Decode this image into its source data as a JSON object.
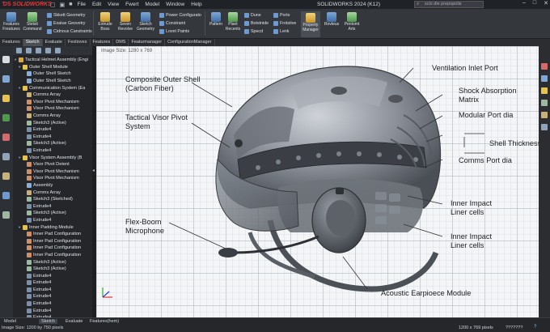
{
  "titlebar": {
    "logo_text": "SOLIDWORKS",
    "menus": [
      "File",
      "Edit",
      "View",
      "Fwert",
      "Model",
      "Window",
      "Help"
    ],
    "app_title": "SOLIDWORKS 2024 (K12)",
    "search_placeholder": "sclo dle prepopolis"
  },
  "command_manager": {
    "big_buttons": [
      {
        "label": "Features\nFreatures",
        "icon": "features-icon"
      },
      {
        "label": "Stetsit\nCommand",
        "icon": "sketch-icon"
      },
      {
        "label": "Extrude\nBoss",
        "icon": "extrude-icon"
      },
      {
        "label": "Seven\nRevolve",
        "icon": "revolve-icon"
      },
      {
        "label": "Sketch\nGeometry",
        "icon": "sketch-geometry-icon"
      },
      {
        "label": "Pattern",
        "icon": "pattern-icon"
      },
      {
        "label": "Plant\nRecents",
        "icon": "plant-icon"
      },
      {
        "label": "Property\nManager",
        "icon": "property-icon"
      },
      {
        "label": "Rovteus",
        "icon": "route-icon"
      },
      {
        "label": "Pentomt\nArts",
        "icon": "arts-icon"
      }
    ],
    "rows_a": [
      "Skkett Geometry",
      "Exatue Geovetry",
      "Cidnous Canstraints"
    ],
    "rows_b": [
      "Power Configurato",
      "Constraint",
      "Lovet Paints"
    ],
    "rows_c": [
      "Dune",
      "Botstnide",
      "Specd"
    ],
    "rows_d": [
      "Ports",
      "Frotstive",
      "Lenk"
    ]
  },
  "tabs": [
    "Features",
    "Sketch",
    "Evaluate",
    "Festioves",
    "Features",
    "DMS",
    "Featurmanager",
    "ConfigurationManager"
  ],
  "tree": {
    "rows": [
      {
        "indent": 0,
        "toggle": "▾",
        "icon": "ic-asm",
        "label": "Tactical Helmet Assembly (Engi"
      },
      {
        "indent": 1,
        "toggle": "▾",
        "icon": "ic-fold",
        "label": "Outer Shell Module"
      },
      {
        "indent": 2,
        "toggle": "",
        "icon": "ic-feat",
        "label": "Outer Shell Sketch"
      },
      {
        "indent": 2,
        "toggle": "",
        "icon": "ic-feat",
        "label": "Outer Shell Sketch"
      },
      {
        "indent": 1,
        "toggle": "▾",
        "icon": "ic-fold",
        "label": "Communication System (Ea"
      },
      {
        "indent": 2,
        "toggle": "",
        "icon": "ic-arr",
        "label": "Comms Array"
      },
      {
        "indent": 2,
        "toggle": "",
        "icon": "ic-pat",
        "label": "Visor Pivot Mechanism"
      },
      {
        "indent": 2,
        "toggle": "",
        "icon": "ic-pat",
        "label": "Visor Pivot Mechanism"
      },
      {
        "indent": 2,
        "toggle": "",
        "icon": "ic-arr",
        "label": "Comms Array"
      },
      {
        "indent": 2,
        "toggle": "",
        "icon": "ic-sk",
        "label": "Sketch3 (Active)"
      },
      {
        "indent": 2,
        "toggle": "",
        "icon": "ic-ext",
        "label": "Extrude4"
      },
      {
        "indent": 2,
        "toggle": "",
        "icon": "ic-ext",
        "label": "Extrude4"
      },
      {
        "indent": 2,
        "toggle": "",
        "icon": "ic-sk",
        "label": "Sketch3 (Active)"
      },
      {
        "indent": 2,
        "toggle": "",
        "icon": "ic-ext",
        "label": "Extrude4"
      },
      {
        "indent": 1,
        "toggle": "▾",
        "icon": "ic-fold",
        "label": "Visor System Assembly (B"
      },
      {
        "indent": 2,
        "toggle": "",
        "icon": "ic-pat",
        "label": "Visor Pivot Detent"
      },
      {
        "indent": 2,
        "toggle": "",
        "icon": "ic-pat",
        "label": "Visor Pivot Mechanism"
      },
      {
        "indent": 2,
        "toggle": "",
        "icon": "ic-pat",
        "label": "Visor Pivot Mechanism"
      },
      {
        "indent": 2,
        "toggle": "",
        "icon": "ic-feat",
        "label": "Assembly"
      },
      {
        "indent": 2,
        "toggle": "",
        "icon": "ic-arr",
        "label": "Comms Array"
      },
      {
        "indent": 2,
        "toggle": "",
        "icon": "ic-sk",
        "label": "Sketch3 (Sketched)"
      },
      {
        "indent": 2,
        "toggle": "",
        "icon": "ic-ext",
        "label": "Extrude4"
      },
      {
        "indent": 2,
        "toggle": "",
        "icon": "ic-sk",
        "label": "Sketch3 (Active)"
      },
      {
        "indent": 2,
        "toggle": "",
        "icon": "ic-ext",
        "label": "Extrude4"
      },
      {
        "indent": 1,
        "toggle": "▾",
        "icon": "ic-fold",
        "label": "Inner Padding Module"
      },
      {
        "indent": 2,
        "toggle": "",
        "icon": "ic-pat",
        "label": "Inner Pad Configuration"
      },
      {
        "indent": 2,
        "toggle": "",
        "icon": "ic-pat",
        "label": "Inner Pad Configuration"
      },
      {
        "indent": 2,
        "toggle": "",
        "icon": "ic-pat",
        "label": "Inner Pad Configuration"
      },
      {
        "indent": 2,
        "toggle": "",
        "icon": "ic-pat",
        "label": "Inner Pad Configuration"
      },
      {
        "indent": 2,
        "toggle": "",
        "icon": "ic-sk",
        "label": "Sketch3 (Active)"
      },
      {
        "indent": 2,
        "toggle": "",
        "icon": "ic-sk",
        "label": "Sketch3 (Active)"
      },
      {
        "indent": 2,
        "toggle": "",
        "icon": "ic-ext",
        "label": "Extrude4"
      },
      {
        "indent": 2,
        "toggle": "",
        "icon": "ic-ext",
        "label": "Extrude4"
      },
      {
        "indent": 2,
        "toggle": "",
        "icon": "ic-ext",
        "label": "Extrude4"
      },
      {
        "indent": 2,
        "toggle": "",
        "icon": "ic-ext",
        "label": "Extrude4"
      },
      {
        "indent": 2,
        "toggle": "",
        "icon": "ic-ext",
        "label": "Extrude4"
      },
      {
        "indent": 2,
        "toggle": "",
        "icon": "ic-ext",
        "label": "Extrude4"
      },
      {
        "indent": 2,
        "toggle": "",
        "icon": "ic-ext",
        "label": "Extrude4"
      }
    ]
  },
  "viewport": {
    "image_size": "Image Size: 1280 x 769",
    "callouts": {
      "outer_shell": "Composite Outer Shell\n(Carbon Fiber)",
      "visor_pivot": "Tactical Visor Pivot\nSystem",
      "ventilation": "Ventilation Inlet Port",
      "shock": "Shock Absorption\nMatrix",
      "modular_port": "Modular Port dia",
      "shell_thickness": "Shell Thickness",
      "comms_port": "Comms Port dia",
      "liner_1": "Inner Impact\nLiner cells",
      "liner_2": "Inner Impact\nLiner cells",
      "flexboom": "Flex-Boom\nMicrophone",
      "earpiece": "Acoustic Earpioece Module"
    }
  },
  "status": {
    "left": "Image Size: 1200 by 750 pixels",
    "bottom_tabs": [
      "Model",
      "Sketch",
      "Evaluate",
      "Features(hem)"
    ],
    "center": "1200 x 769 pixels",
    "units": "???????",
    "help": "?"
  },
  "colors": {
    "accent": "#e23b3b",
    "panel": "#24262a",
    "viewport": "#f4f5f7"
  }
}
